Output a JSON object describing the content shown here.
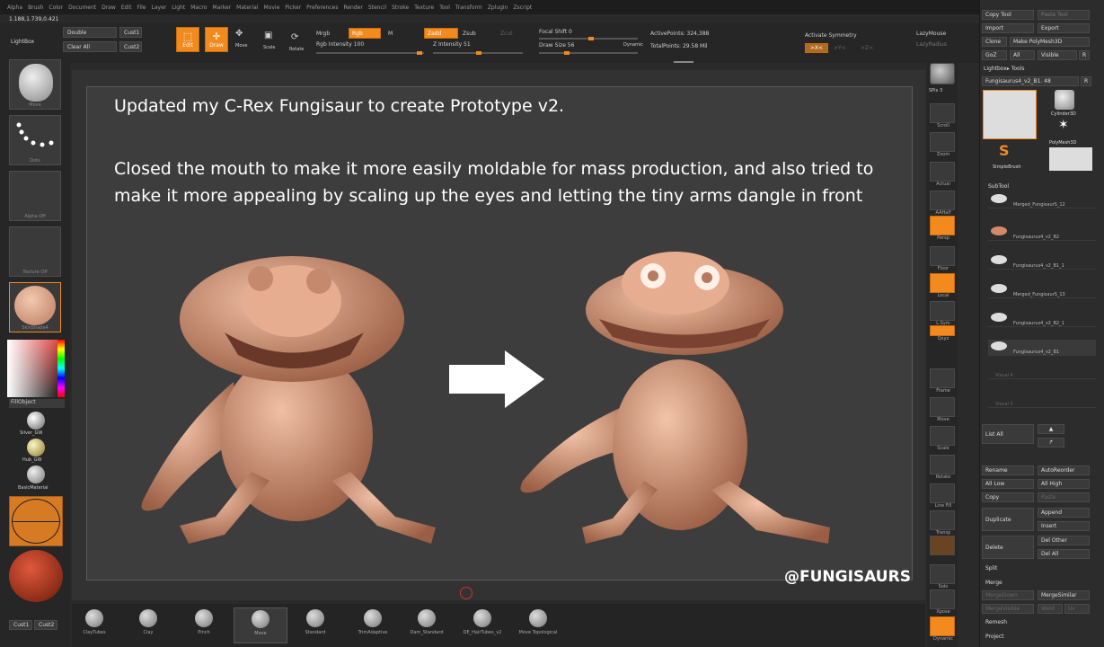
{
  "menu": [
    "Alpha",
    "Brush",
    "Color",
    "Document",
    "Draw",
    "Edit",
    "File",
    "Layer",
    "Light",
    "Macro",
    "Marker",
    "Material",
    "Movie",
    "Picker",
    "Preferences",
    "Render",
    "Stencil",
    "Stroke",
    "Texture",
    "Tool",
    "Transform",
    "Zplugin",
    "Zscript"
  ],
  "coords": "1.188,1.739,0.421",
  "topbar": {
    "lightbox": "LightBox",
    "double": "Double",
    "clear_all": "Clear All",
    "cust1": "Cust1",
    "cust2": "Cust2",
    "edit": "Edit",
    "draw": "Draw",
    "move": "Move",
    "scale": "Scale",
    "rotate": "Rotate",
    "mrgb": "Mrgb",
    "rgb": "Rgb",
    "m": "M",
    "zadd": "Zadd",
    "zsub": "Zsub",
    "zcut": "Zcut",
    "rgb_intensity": "Rgb Intensity 100",
    "z_intensity": "Z Intensity 51",
    "focal_shift": "Focal Shift 0",
    "draw_size": "Draw Size 56",
    "dynamic": "Dynamic",
    "active_points": "ActivePoints: 324,388",
    "total_points": "TotalPoints: 29.58 Mil",
    "activate_symmetry": "Activate Symmetry",
    "lazymouse": "LazyMouse",
    "lazyradius": "LazyRadius",
    "sym_x": ">X<",
    "sym_y": ">Y<",
    "sym_z": ">Z<"
  },
  "left_shelf": {
    "move": "Move",
    "dots": "Dots",
    "alpha_off": "Alpha Off",
    "texture_off": "Texture Off",
    "skin_shade": "SkinShade4",
    "fill_object": "FillObject",
    "silver": "Silver_GW",
    "hub": "Hub_GW",
    "basic_material": "BasicMaterial",
    "cust1": "Cust1",
    "cust2": "Cust2"
  },
  "post": {
    "headline": "Updated my C-Rex Fungisaur to create Prototype v2.",
    "body": "Closed the mouth to make it more easily moldable for mass production, and also tried to make it more appealing by scaling up the eyes and letting the tiny arms dangle in front",
    "handle": "@FUNGISAURS"
  },
  "right_tools": [
    "SPix 3",
    "Scroll",
    "Zoom",
    "Actual",
    "AAHalf",
    "Persp",
    "Floor",
    "Local",
    "L.Sym",
    "Qxyz",
    "Frame",
    "Move",
    "Scale",
    "Rotate",
    "Line Fill",
    "Transp",
    "Solo",
    "Xpose",
    "Dynamic"
  ],
  "side_panel": {
    "copy_tool": "Copy Tool",
    "paste_tool": "Paste Tool",
    "import": "Import",
    "export": "Export",
    "clone": "Clone",
    "make_polymesh": "Make PolyMesh3D",
    "goz": "GoZ",
    "all": "All",
    "visible": "Visible",
    "r": "R",
    "lightbox_tools": "Lightbox▸ Tools",
    "current_tool": "Fungisaurus4_v2_B1. 48",
    "r2": "R",
    "cylinder": "Cylinder3D",
    "polymesh": "PolyMesh3D",
    "simplebrush": "SimpleBrush",
    "subtool": "SubTool",
    "subtools": [
      "Merged_FungisaurS_12",
      "Fungisaurus4_v2_B2",
      "Fungisaurus4_v2_B1_1",
      "Merged_FungisaurS_13",
      "Fungisaurus4_v2_B2_1",
      "Fungisaurus4_v2_B1",
      "Visual 4",
      "Visual 3"
    ],
    "list_all": "List All",
    "rename": "Rename",
    "autoreorder": "AutoReorder",
    "all_low": "All Low",
    "all_high": "All High",
    "copy": "Copy",
    "paste": "Paste",
    "duplicate": "Duplicate",
    "append": "Append",
    "insert": "Insert",
    "delete": "Delete",
    "del_other": "Del Other",
    "del_all": "Del All",
    "split": "Split",
    "merge": "Merge",
    "merge_down": "MergeDown",
    "merge_similar": "MergeSimilar",
    "merge_visible": "MergeVisible",
    "weld": "Weld",
    "uv": "Uv",
    "remesh": "Remesh",
    "project": "Project"
  },
  "bottom_brushes": [
    "ClayTubes",
    "Clay",
    "Pinch",
    "Move",
    "Standard",
    "TrimAdaptive",
    "Dam_Standard",
    "DE_HairTubes_v2",
    "Move Topological"
  ],
  "colors": {
    "accent": "#f28a1e",
    "clay": "#d49a7a",
    "background": "#3d3d3d"
  }
}
